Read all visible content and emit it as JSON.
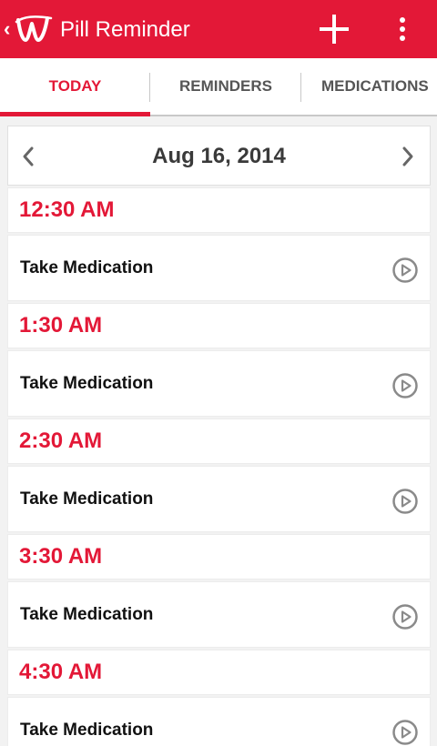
{
  "appbar": {
    "title": "Pill Reminder",
    "brand_color": "#e31837",
    "back_icon": "chevron-left-icon",
    "logo_icon": "walgreens-w-logo",
    "add_icon": "plus-icon",
    "more_icon": "overflow-menu-icon"
  },
  "tabs": [
    {
      "label": "TODAY",
      "active": true
    },
    {
      "label": "REMINDERS",
      "active": false
    },
    {
      "label": "MEDICATIONS",
      "active": false
    }
  ],
  "date_nav": {
    "date": "Aug 16, 2014",
    "prev_icon": "chevron-left-icon",
    "next_icon": "chevron-right-icon"
  },
  "schedule": [
    {
      "time": "12:30 AM",
      "item": "Take Medication"
    },
    {
      "time": "1:30 AM",
      "item": "Take Medication"
    },
    {
      "time": "2:30 AM",
      "item": "Take Medication"
    },
    {
      "time": "3:30 AM",
      "item": "Take Medication"
    },
    {
      "time": "4:30 AM",
      "item": "Take Medication"
    }
  ]
}
